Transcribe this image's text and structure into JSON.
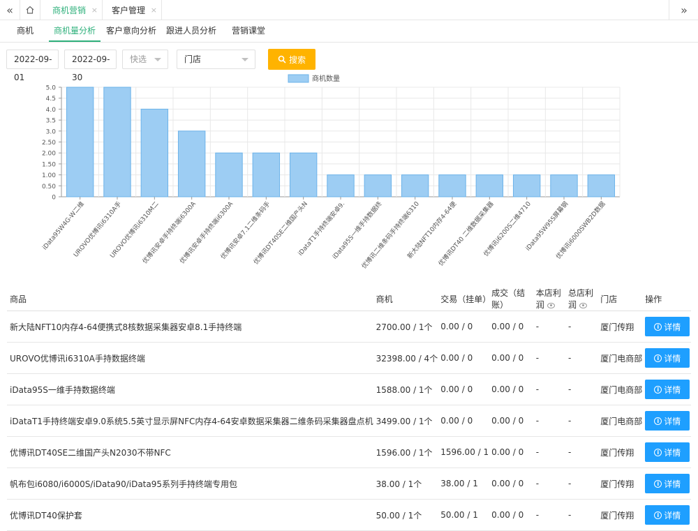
{
  "tabbar": {
    "home_icon": "home-icon",
    "tabs": [
      {
        "label": "商机营销",
        "active": true
      },
      {
        "label": "客户管理",
        "active": false
      }
    ],
    "close_glyph": "×"
  },
  "subnav": {
    "items": [
      {
        "label": "商机"
      },
      {
        "label": "商机量分析",
        "active": true
      },
      {
        "label": "客户意向分析"
      },
      {
        "label": "跟进人员分析"
      },
      {
        "label": "营销课堂"
      }
    ]
  },
  "filters": {
    "start_date": "2022-09-01",
    "end_date": "2022-09-30",
    "quick_placeholder": "快选",
    "store_placeholder": "门店",
    "search_label": "搜索"
  },
  "chart_data": {
    "type": "bar",
    "legend": "商机数量",
    "legend_position": "top-center",
    "color": "#9dcdf3",
    "border_color": "#6cb3ea",
    "ylim": [
      0,
      5
    ],
    "yticks": [
      "0",
      "0.50",
      "1.00",
      "1.50",
      "2.00",
      "2.50",
      "3.0",
      "3.5",
      "4.0",
      "4.5",
      "5.0"
    ],
    "grid": true,
    "categories": [
      "iData95W4G-W二维",
      "UROVO优博讯i6310A手",
      "UROVO优博讯i6310M二",
      "优博讯安卓手持终端i6300A",
      "优博讯安卓手持终端i6300A",
      "优博讯安卓7.1二维条码手",
      "优博讯DT40SE二维国产头N",
      "iDataT1手持终端安卓9.",
      "iData95S一维手持数据终",
      "优博讯二维条码手持终端6310",
      "新大陆NFT10内存4-64便",
      "优博讯DT40 二维数据采集器",
      "优博讯i6200S二维4710",
      "iData95W95S屏幕钢",
      "优博讯i6000SWB2D数据"
    ],
    "values": [
      5,
      5,
      4,
      3,
      2,
      2,
      2,
      1,
      1,
      1,
      1,
      1,
      1,
      1,
      1
    ]
  },
  "table": {
    "headers": {
      "product": "商品",
      "opportunity": "商机",
      "trade": "交易（挂单）",
      "deal": "成交（结账）",
      "store_profit": "本店利润",
      "total_profit": "总店利润",
      "store": "门店",
      "action": "操作"
    },
    "detail_label": "详情",
    "rows": [
      {
        "product": "新大陆NFT10内存4-64便携式8核数据采集器安卓8.1手持终端",
        "opportunity": "2700.00 / 1个",
        "trade": "0.00 / 0",
        "deal": "0.00 / 0",
        "store_profit": "-",
        "total_profit": "-",
        "store": "厦门传翔"
      },
      {
        "product": "UROVO优博讯i6310A手持数据终端",
        "opportunity": "32398.00 / 4个",
        "trade": "0.00 / 0",
        "deal": "0.00 / 0",
        "store_profit": "-",
        "total_profit": "-",
        "store": "厦门电商部"
      },
      {
        "product": "iData95S一维手持数据终端",
        "opportunity": "1588.00 / 1个",
        "trade": "0.00 / 0",
        "deal": "0.00 / 0",
        "store_profit": "-",
        "total_profit": "-",
        "store": "厦门电商部"
      },
      {
        "product": "iDataT1手持终端安卓9.0系统5.5英寸显示屏NFC内存4-64安卓数据采集器二维条码采集器盘点机",
        "opportunity": "3499.00 / 1个",
        "trade": "0.00 / 0",
        "deal": "0.00 / 0",
        "store_profit": "-",
        "total_profit": "-",
        "store": "厦门电商部"
      },
      {
        "product": "优博讯DT40SE二维国产头N2030不带NFC",
        "opportunity": "1596.00 / 1个",
        "trade": "1596.00 / 1",
        "deal": "0.00 / 0",
        "store_profit": "-",
        "total_profit": "-",
        "store": "厦门传翔"
      },
      {
        "product": "帆布包i6080/i6000S/iData90/iData95系列手持终端专用包",
        "opportunity": "38.00 / 1个",
        "trade": "38.00 / 1",
        "deal": "0.00 / 0",
        "store_profit": "-",
        "total_profit": "-",
        "store": "厦门传翔"
      },
      {
        "product": "优博讯DT40保护套",
        "opportunity": "50.00 / 1个",
        "trade": "50.00 / 1",
        "deal": "0.00 / 0",
        "store_profit": "-",
        "total_profit": "-",
        "store": "厦门传翔"
      }
    ]
  }
}
